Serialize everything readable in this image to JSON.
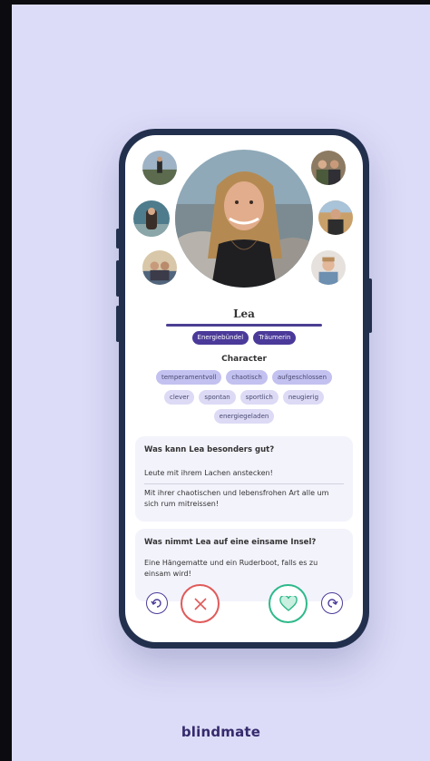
{
  "brand": "blindmate",
  "profile": {
    "name": "Lea",
    "tags": [
      "Energiebündel",
      "Träumerin"
    ]
  },
  "character": {
    "title": "Character",
    "rows": [
      [
        "temperamentvoll",
        "chaotisch",
        "aufgeschlossen"
      ],
      [
        "clever",
        "spontan",
        "sportlich",
        "neugierig"
      ],
      [
        "energiegeladen"
      ]
    ]
  },
  "questions": [
    {
      "question": "Was kann Lea besonders gut?",
      "answers": [
        "Leute mit ihrem Lachen anstecken!",
        "Mit ihrer chaotischen und lebensfrohen Art alle um sich rum mitreissen!"
      ]
    },
    {
      "question": "Was nimmt Lea auf eine einsame Insel?",
      "answers": [
        "Eine Hängematte und ein Ruderboot, falls es zu einsam wird!"
      ]
    }
  ],
  "icons": {
    "undo": "undo-icon",
    "dislike": "close-icon",
    "like": "heart-icon",
    "redo": "redo-icon"
  },
  "colors": {
    "accent": "#4b3a99",
    "dislike": "#e05a5a",
    "like": "#2fb98a",
    "background": "#dcdcf8"
  }
}
